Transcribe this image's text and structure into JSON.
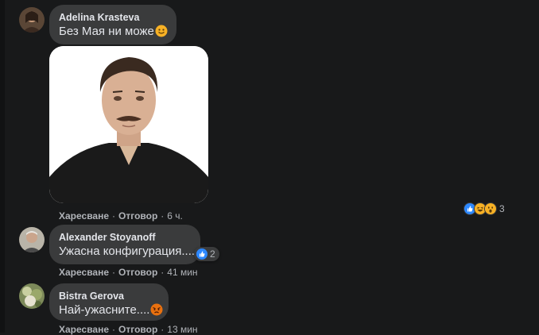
{
  "comments": [
    {
      "author": "Adelina Krasteva",
      "text": "Без Мая ни може",
      "text_emoji": "slightly-smiling-emoji",
      "actions": {
        "like": "Харесване",
        "reply": "Отговор",
        "time": "6 ч."
      },
      "reactions": {
        "icons": [
          "like-reaction-icon",
          "laugh-reaction-icon",
          "wow-reaction-icon"
        ],
        "count": "3"
      }
    },
    {
      "author": "Alexander Stoyanoff",
      "text": "Ужасна конфигурация....",
      "actions": {
        "like": "Харесване",
        "reply": "Отговор",
        "time": "41 мин"
      },
      "reactions": {
        "icons": [
          "like-reaction-icon"
        ],
        "count": "2"
      }
    },
    {
      "author": "Bistra Gerova",
      "text": "Най-ужасните....",
      "text_emoji": "angry-face-emoji",
      "actions": {
        "like": "Харесване",
        "reply": "Отговор",
        "time": "13 мин"
      }
    }
  ],
  "colors": {
    "background": "#18191a",
    "bubble": "#3a3b3c",
    "text": "#e4e6eb",
    "secondary_text": "#b0b3b8",
    "like_blue": "#2d88ff",
    "reaction_yellow": "#f7b125",
    "angry_red": "#e9710f"
  }
}
